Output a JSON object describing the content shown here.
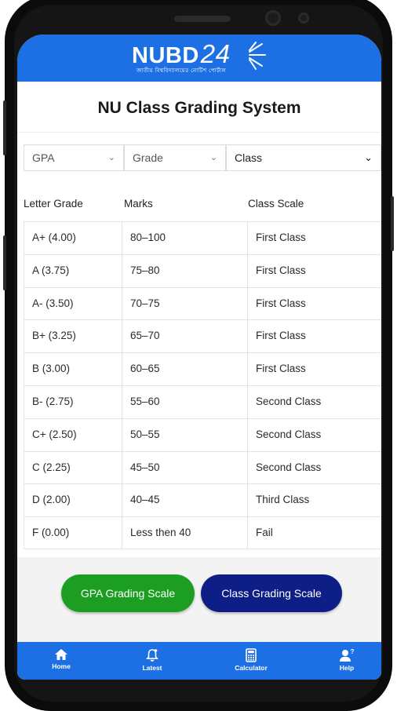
{
  "app": {
    "logo_text": "NUBD",
    "logo_number": "24",
    "logo_subtitle": "জাতীয় বিশ্ববিদ্যালয়ের নোটিশ পোর্টাল"
  },
  "page": {
    "title": "NU Class Grading System"
  },
  "filters": [
    {
      "label": "GPA"
    },
    {
      "label": "Grade"
    },
    {
      "label": "Class"
    }
  ],
  "table": {
    "headers": [
      "Letter Grade",
      "Marks",
      "Class Scale"
    ],
    "rows": [
      {
        "grade": "A+ (4.00)",
        "marks": "80–100",
        "class": "First Class"
      },
      {
        "grade": "A (3.75)",
        "marks": "75–80",
        "class": "First Class"
      },
      {
        "grade": "A- (3.50)",
        "marks": "70–75",
        "class": "First Class"
      },
      {
        "grade": "B+ (3.25)",
        "marks": "65–70",
        "class": "First Class"
      },
      {
        "grade": "B (3.00)",
        "marks": "60–65",
        "class": "First Class"
      },
      {
        "grade": "B- (2.75)",
        "marks": "55–60",
        "class": "Second Class"
      },
      {
        "grade": "C+ (2.50)",
        "marks": "50–55",
        "class": "Second Class"
      },
      {
        "grade": "C (2.25)",
        "marks": "45–50",
        "class": "Second Class"
      },
      {
        "grade": "D (2.00)",
        "marks": "40–45",
        "class": "Third Class"
      },
      {
        "grade": "F (0.00)",
        "marks": "Less then 40",
        "class": "Fail"
      }
    ]
  },
  "buttons": {
    "gpa_label": "GPA Grading Scale",
    "class_label": "Class Grading Scale"
  },
  "nav": [
    {
      "label": "Home",
      "icon": "home-icon"
    },
    {
      "label": "Latest",
      "icon": "bell-icon"
    },
    {
      "label": "Calculator",
      "icon": "calculator-icon"
    },
    {
      "label": "Help",
      "icon": "help-user-icon"
    }
  ],
  "colors": {
    "primary_blue": "#1d70e3",
    "gpa_button": "#1b9e22",
    "class_button": "#0d1f86"
  }
}
